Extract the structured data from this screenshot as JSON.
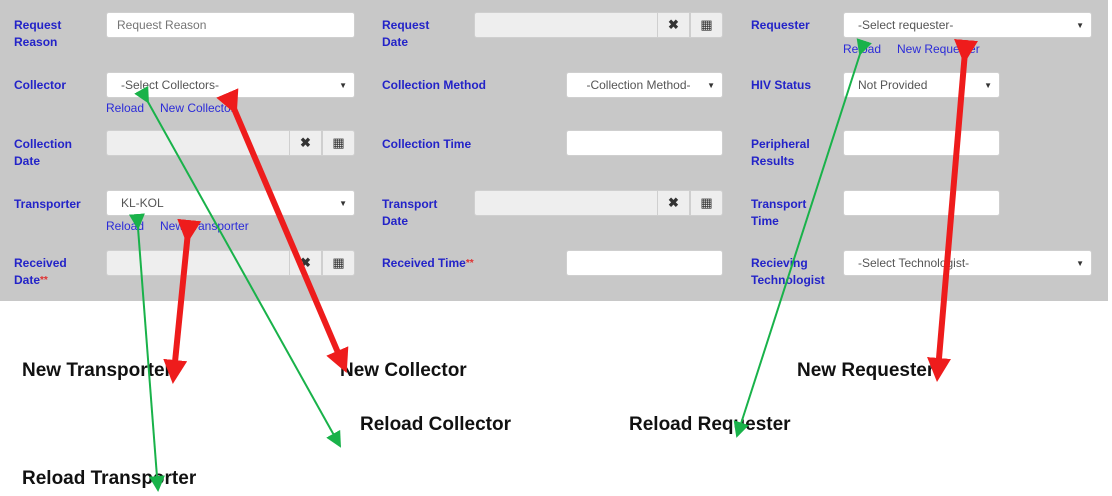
{
  "form": {
    "request_reason": {
      "label": "Request Reason",
      "placeholder": "Request Reason"
    },
    "request_date": {
      "label": "Request Date"
    },
    "requester": {
      "label": "Requester",
      "value": "-Select requester-",
      "reload": "Reload",
      "new": "New Requester"
    },
    "collector": {
      "label": "Collector",
      "value": "-Select Collectors-",
      "reload": "Reload",
      "new": "New Collector"
    },
    "collection_method": {
      "label": "Collection Method",
      "value": "-Collection Method-"
    },
    "hiv_status": {
      "label": "HIV Status",
      "value": "Not Provided"
    },
    "collection_date": {
      "label": "Collection Date"
    },
    "collection_time": {
      "label": "Collection Time"
    },
    "peripheral_results": {
      "label": "Peripheral Results"
    },
    "transporter": {
      "label": "Transporter",
      "value": "KL-KOL",
      "reload": "Reload",
      "new": "New Transporter"
    },
    "transport_date": {
      "label": "Transport Date"
    },
    "transport_time": {
      "label": "Transport Time"
    },
    "received_date": {
      "label": "Received Date",
      "required": "**"
    },
    "received_time": {
      "label": "Received Time",
      "required": "**"
    },
    "receiving_technologist": {
      "label": "Recieving Technologist",
      "value": "-Select Technologist-"
    }
  },
  "icons": {
    "clear": "close-icon",
    "calendar": "calendar-icon",
    "dropdown": "caret-down-icon"
  },
  "annotations": {
    "new_transporter": "New Transporter",
    "new_collector": "New Collector",
    "new_requester": "New Requester",
    "reload_collector": "Reload Collector",
    "reload_requester": "Reload Requester",
    "reload_transporter": "Reload Transporter"
  },
  "colors": {
    "panel": "#c8c8c8",
    "label": "#2323c8",
    "link": "#2b2bd8",
    "arrow_red": "#ee1c1c",
    "arrow_green": "#19b24a"
  }
}
